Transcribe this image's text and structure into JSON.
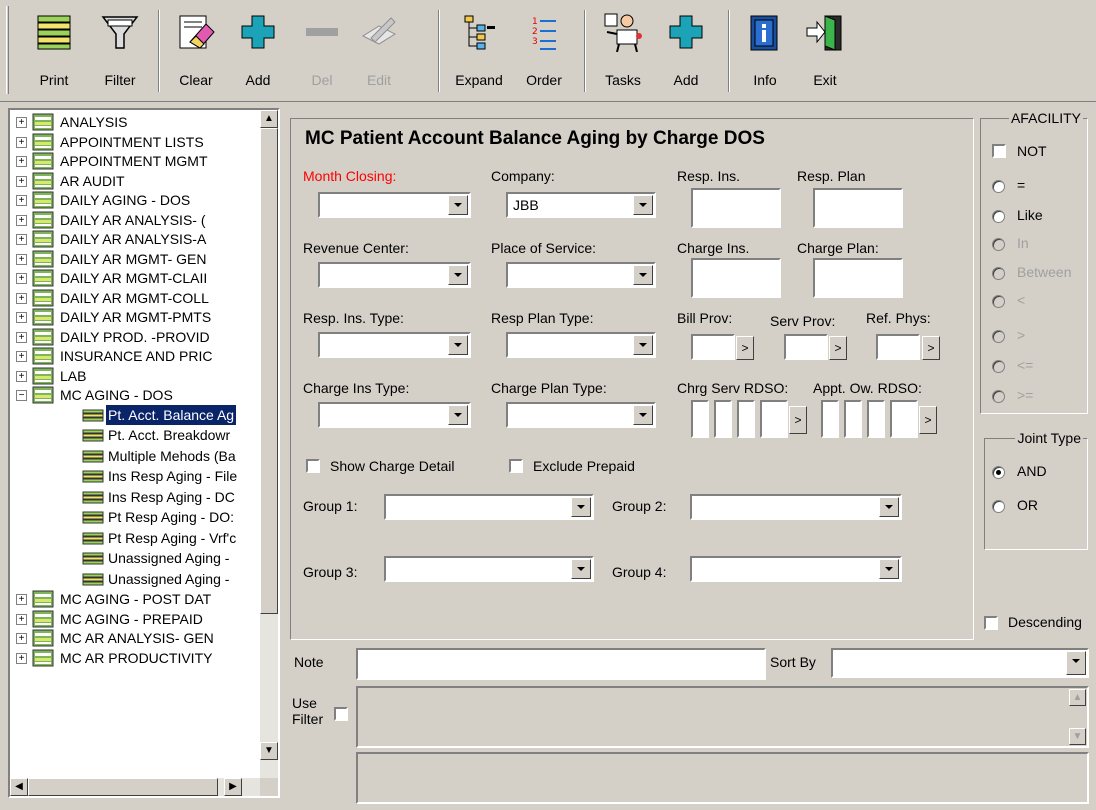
{
  "toolbar": {
    "print": "Print",
    "filter": "Filter",
    "clear": "Clear",
    "add": "Add",
    "del": "Del",
    "edit": "Edit",
    "expand": "Expand",
    "order": "Order",
    "tasks": "Tasks",
    "add2": "Add",
    "info": "Info",
    "exit": "Exit"
  },
  "tree": {
    "items": [
      "ANALYSIS",
      "APPOINTMENT LISTS",
      "APPOINTMENT MGMT",
      "AR AUDIT",
      "DAILY AGING - DOS",
      "DAILY AR ANALYSIS- (",
      "DAILY AR ANALYSIS-A",
      "DAILY AR MGMT- GEN",
      "DAILY AR MGMT-CLAII",
      "DAILY AR MGMT-COLL",
      "DAILY AR MGMT-PMTS",
      "DAILY PROD. -PROVID",
      "INSURANCE AND PRIC",
      "LAB",
      "MC AGING - DOS"
    ],
    "children": [
      "Pt. Acct. Balance Ag",
      "Pt. Acct. Breakdowr",
      "Multiple Mehods (Ba",
      "Ins Resp Aging - File",
      "Ins Resp Aging - DC",
      "Pt Resp Aging - DO:",
      "Pt Resp Aging - Vrf'c",
      "Unassigned Aging -",
      "Unassigned Aging -"
    ],
    "after": [
      "MC AGING - POST DAT",
      "MC AGING - PREPAID",
      "MC AR ANALYSIS- GEN",
      "MC AR PRODUCTIVITY"
    ]
  },
  "form": {
    "title": "MC Patient Account Balance Aging by Charge DOS",
    "month_closing": "Month Closing:",
    "company": "Company:",
    "company_value": "JBB",
    "resp_ins": "Resp. Ins.",
    "resp_plan": "Resp. Plan",
    "revenue_center": "Revenue Center:",
    "place_of_service": "Place of Service:",
    "charge_ins": "Charge Ins.",
    "charge_plan": "Charge Plan:",
    "resp_ins_type": "Resp. Ins. Type:",
    "resp_plan_type": "Resp Plan Type:",
    "bill_prov": "Bill Prov:",
    "serv_prov": "Serv Prov:",
    "ref_phys": "Ref. Phys:",
    "charge_ins_type": "Charge Ins Type:",
    "charge_plan_type": "Charge Plan Type:",
    "chrg_serv_rdso": "Chrg Serv RDSO:",
    "appt_ow_rdso": "Appt. Ow. RDSO:",
    "show_charge_detail": "Show Charge Detail",
    "exclude_prepaid": "Exclude Prepaid",
    "group1": "Group 1:",
    "group2": "Group 2:",
    "group3": "Group 3:",
    "group4": "Group 4:",
    "note": "Note",
    "sort_by": "Sort By",
    "use_filter": "Use\nFilter",
    "picker_glyph": ">"
  },
  "afacility": {
    "caption": "AFACILITY",
    "not": "NOT",
    "eq": "=",
    "like": "Like",
    "in": "In",
    "between": "Between",
    "lt": "<",
    "gt": ">",
    "le": "<=",
    "ge": ">="
  },
  "joint": {
    "caption": "Joint Type",
    "and": "AND",
    "or": "OR"
  },
  "descending": "Descending"
}
